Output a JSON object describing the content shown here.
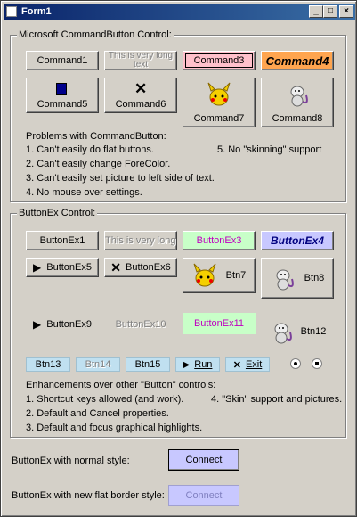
{
  "window": {
    "title": "Form1",
    "min_label": "_",
    "max_label": "□",
    "close_label": "×"
  },
  "frame1": {
    "title": "Microsoft CommandButton Control:",
    "buttons": {
      "command1": "Command1",
      "command2": "This is very long text",
      "command3": "Command3",
      "command4": "Command4",
      "command5": "Command5",
      "command6": "Command6",
      "command7": "Command7",
      "command8": "Command8"
    },
    "problems_heading": "Problems with CommandButton:",
    "problems": [
      "1.  Can't easily do flat buttons.",
      "2.  Can't easily change ForeColor.",
      "3.  Can't easily set picture to left side of text.",
      "4.  No mouse over settings."
    ],
    "problem5": "5. No \"skinning\" support"
  },
  "frame2": {
    "title": "ButtonEx Control:",
    "buttons": {
      "bx1": "ButtonEx1",
      "bx2": "This is very long text",
      "bx3": "ButtonEx3",
      "bx4": "ButtonEx4",
      "bx5": "ButtonEx5",
      "bx6": "ButtonEx6",
      "btn7": "Btn7",
      "btn8": "Btn8",
      "bx9": "ButtonEx9",
      "bx10": "ButtonEx10",
      "bx11": "ButtonEx11",
      "btn12": "Btn12",
      "btn13": "Btn13",
      "btn14": "Btn14",
      "btn15": "Btn15",
      "run": "Run",
      "exit": "Exit"
    },
    "enh_heading": "Enhancements over other \"Button\" controls:",
    "enhancements": [
      "1.  Shortcut keys allowed (and work).",
      "2.  Default and Cancel properties.",
      "3.  Default and focus graphical highlights."
    ],
    "enh4": "4. \"Skin\" support and pictures."
  },
  "bottom": {
    "normal_label": "ButtonEx with normal style:",
    "normal_button": "Connect",
    "flat_label": "ButtonEx with new flat border style:",
    "flat_button": "Connect"
  },
  "colors": {
    "title_blue": "#0a246a",
    "pink": "#ffc0cb",
    "orange": "#ffa54f",
    "green_btn": "#c8ffc8",
    "lavender": "#c8c8ff",
    "magenta_text": "#c000c0",
    "cyan_btn": "#c0e0f0"
  }
}
